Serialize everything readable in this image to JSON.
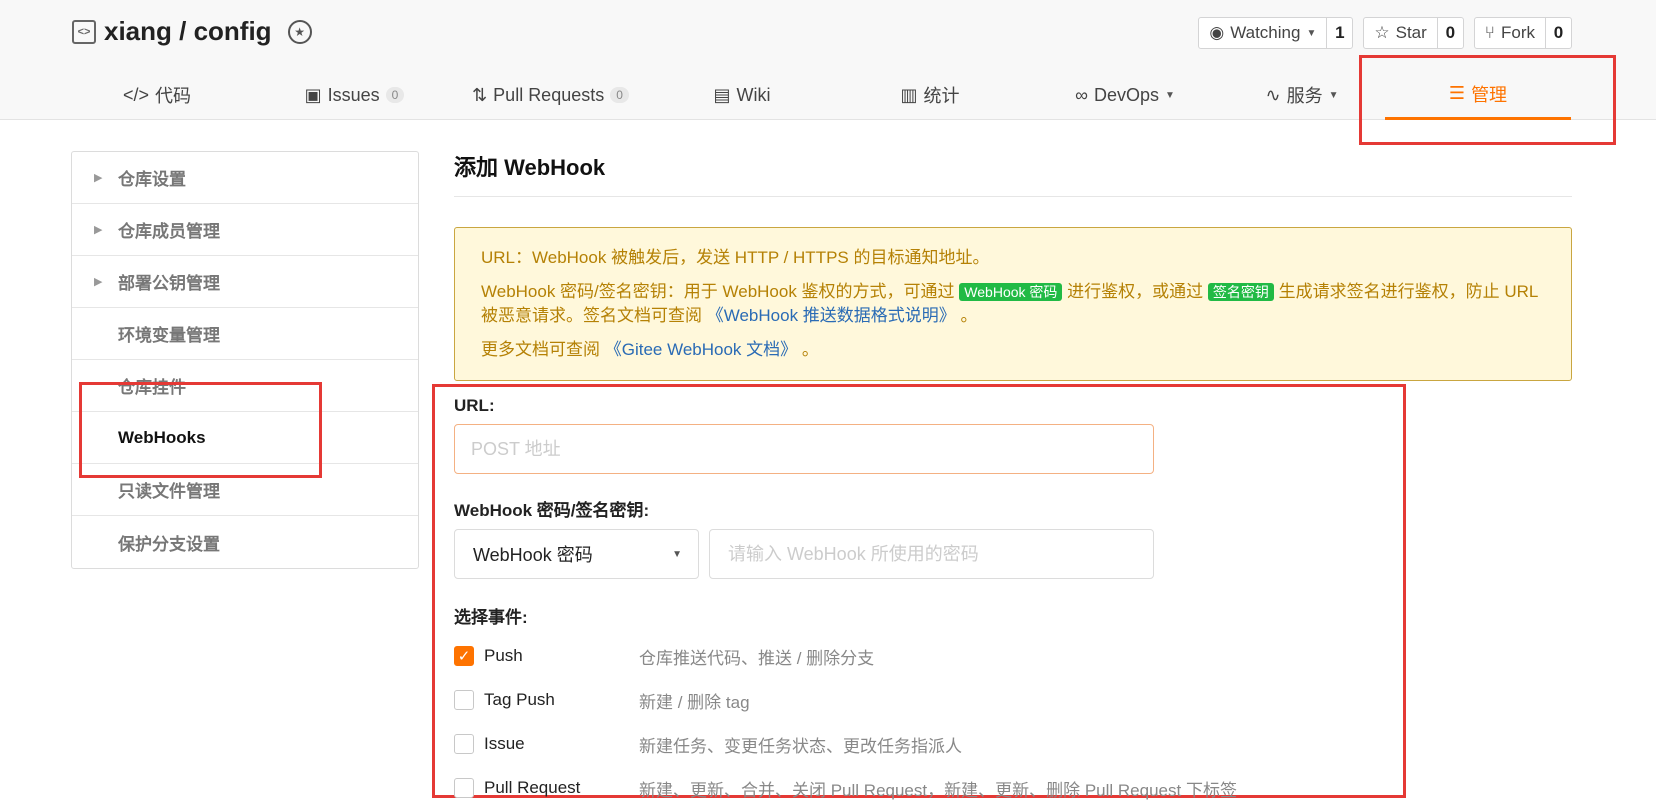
{
  "repo": {
    "name": "xiang / config"
  },
  "actions": [
    {
      "label": "Watching",
      "count": "1",
      "icon": "eye-icon",
      "caret": true
    },
    {
      "label": "Star",
      "count": "0",
      "icon": "star-icon"
    },
    {
      "label": "Fork",
      "count": "0",
      "icon": "fork-icon"
    }
  ],
  "tabs": [
    {
      "label": "代码",
      "icon": "code-icon"
    },
    {
      "label": "Issues",
      "num": "0",
      "icon": "issues-icon"
    },
    {
      "label": "Pull Requests",
      "num": "0",
      "icon": "pull-request-icon"
    },
    {
      "label": "Wiki",
      "icon": "book-icon"
    },
    {
      "label": "统计",
      "icon": "chart-icon"
    },
    {
      "label": "DevOps",
      "icon": "infinity-icon"
    },
    {
      "label": "服务",
      "icon": "pulse-icon"
    },
    {
      "label": "管理",
      "icon": "manage-icon"
    }
  ],
  "sidebar": {
    "items": [
      {
        "label": "仓库设置"
      },
      {
        "label": "仓库成员管理"
      },
      {
        "label": "部署公钥管理"
      },
      {
        "label": "环境变量管理"
      },
      {
        "label": "仓库挂件"
      },
      {
        "label": "WebHooks"
      },
      {
        "label": "只读文件管理"
      },
      {
        "label": "保护分支设置"
      }
    ]
  },
  "main": {
    "title": "添加 WebHook",
    "notice": {
      "line1": "URL：WebHook 被触发后，发送 HTTP / HTTPS 的目标通知地址。",
      "line2_a": "WebHook 密码/签名密钥：用于 WebHook 鉴权的方式，可通过",
      "tag1": "WebHook 密码",
      "line2_b": "进行鉴权，或通过",
      "tag2": "签名密钥",
      "line2_c": "生成请求签名进行鉴权，防止 URL 被恶意请求。签名文档可查阅",
      "link1": "《WebHook 推送数据格式说明》",
      "line2_d": "。",
      "line3_a": "更多文档可查阅",
      "link2": "《Gitee WebHook 文档》",
      "line3_b": "。"
    }
  },
  "form": {
    "url_label": "URL:",
    "url_placeholder": "POST 地址",
    "secret_label": "WebHook 密码/签名密钥:",
    "secret_type": "WebHook 密码",
    "secret_placeholder": "请输入 WebHook 所使用的密码",
    "events_label": "选择事件:",
    "events": [
      {
        "name": "Push",
        "desc": "仓库推送代码、推送 / 删除分支",
        "checked": true
      },
      {
        "name": "Tag Push",
        "desc": "新建 / 删除 tag",
        "checked": false
      },
      {
        "name": "Issue",
        "desc": "新建任务、变更任务状态、更改任务指派人",
        "checked": false
      },
      {
        "name": "Pull Request",
        "desc": "新建、更新、合并、关闭 Pull Request，新建、更新、删除 Pull Request 下标签",
        "checked": false
      }
    ]
  },
  "colors": {
    "accent": "#fe7300",
    "highlight": "#e53935",
    "notice_bg": "#fff8db",
    "tag_green": "#21ba45"
  }
}
